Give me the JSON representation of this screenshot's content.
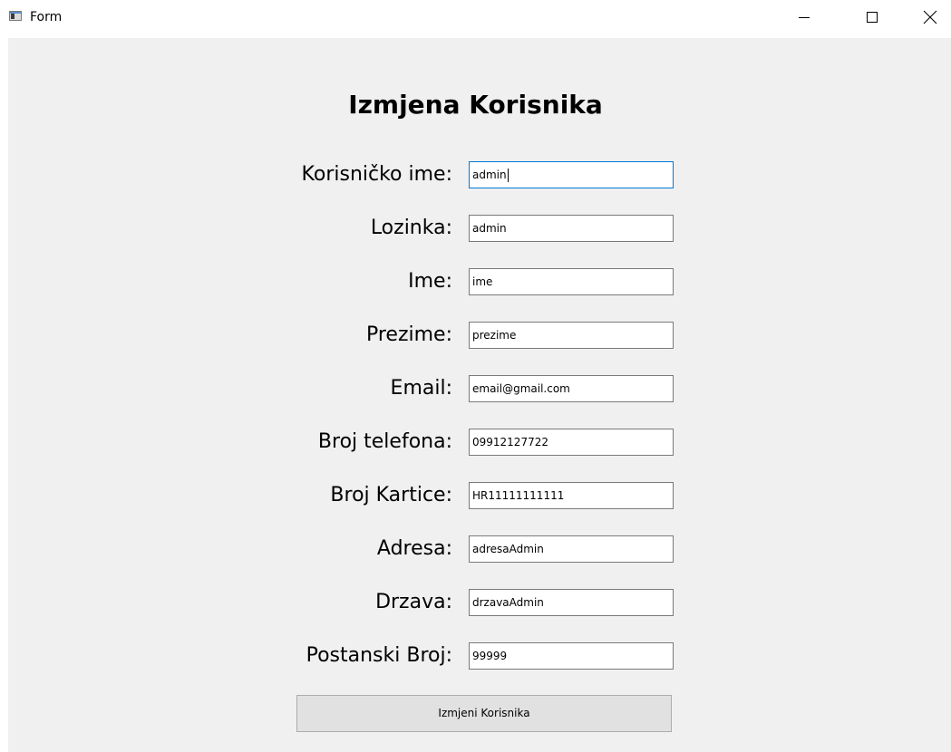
{
  "window": {
    "title": "Form",
    "controls": {
      "minimize": "minimize-icon",
      "maximize": "maximize-icon",
      "close": "close-icon"
    }
  },
  "form": {
    "heading": "Izmjena Korisnika",
    "fields": [
      {
        "label": "Korisničko ime:",
        "value": "admin"
      },
      {
        "label": "Lozinka:",
        "value": "admin"
      },
      {
        "label": "Ime:",
        "value": "ime"
      },
      {
        "label": "Prezime:",
        "value": "prezime"
      },
      {
        "label": "Email:",
        "value": "email@gmail.com"
      },
      {
        "label": "Broj telefona:",
        "value": "09912127722"
      },
      {
        "label": "Broj Kartice:",
        "value": "HR11111111111"
      },
      {
        "label": "Adresa:",
        "value": "adresaAdmin"
      },
      {
        "label": "Drzava:",
        "value": "drzavaAdmin"
      },
      {
        "label": "Postanski Broj:",
        "value": "99999"
      }
    ],
    "submit_label": "Izmjeni Korisnika"
  },
  "colors": {
    "client_bg": "#f0f0f0",
    "focus_border": "#0078d7",
    "field_border": "#7a7a7a",
    "button_bg": "#e1e1e1"
  }
}
